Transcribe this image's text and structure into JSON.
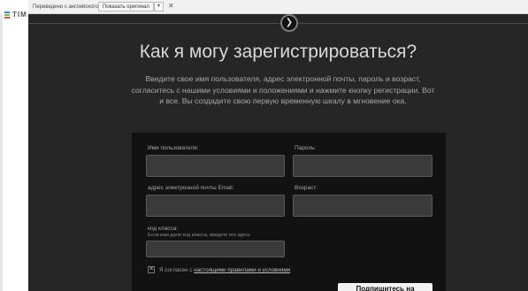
{
  "translate_bar": {
    "text": "Переведено с английского",
    "show_original": "Показать оригинал",
    "dropdown_glyph": "▾",
    "close_glyph": "✕"
  },
  "site": {
    "logo_text": "TIM",
    "logo_colors": [
      "#2c8fd6",
      "#7cc24a",
      "#e84f3d"
    ]
  },
  "modal": {
    "nav_glyph": "❯",
    "title": "Как я могу зарегистрироваться?",
    "description": "Введите свое имя пользователя, адрес электронной почты, пароль и возраст, согласитесь с нашими условиями и положениями и нажмите кнопку регистрации. Вот и все. Вы создадите свою первую временную шкалу в мгновение ока.",
    "form": {
      "username_label": "Имя пользователя:",
      "password_label": "Пароль:",
      "email_label": "адрес электронной почты Email:",
      "age_label": "Возраст:",
      "class_code_label": "код класса:",
      "class_code_hint": "Если вам дали код класса, введите его здесь",
      "username_value": "",
      "password_value": "",
      "email_value": "",
      "age_value": "",
      "class_code_value": "",
      "checkbox_glyph": "✕",
      "agree_prefix": "Я согласен с ",
      "agree_link": "настоящими правилами и условиями",
      "submit_label": "Подпишитесь на"
    }
  }
}
